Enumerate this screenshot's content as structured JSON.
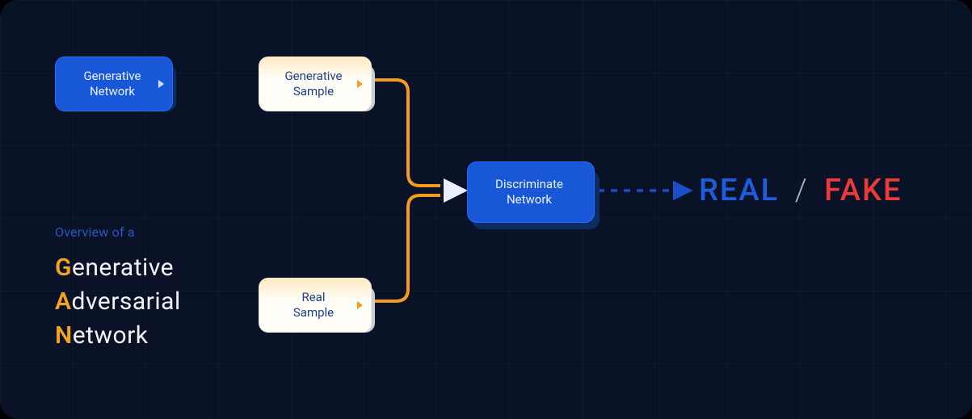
{
  "nodes": {
    "gen_net": {
      "line1": "Generative",
      "line2": "Network"
    },
    "gen_sample": {
      "line1": "Generative",
      "line2": "Sample"
    },
    "real_sample": {
      "line1": "Real",
      "line2": "Sample"
    },
    "discrim": {
      "line1": "Discriminate",
      "line2": "Network"
    }
  },
  "title": {
    "overview": "Overview of a",
    "w1_first": "G",
    "w1_rest": "enerative",
    "w2_first": "A",
    "w2_rest": "dversarial",
    "w3_first": "N",
    "w3_rest": "etwork"
  },
  "output": {
    "real": "REAL",
    "slash": "/",
    "fake": "FAKE"
  },
  "colors": {
    "bg": "#091227",
    "blue_node": "#1857d8",
    "orange": "#f4a321",
    "real": "#1f5de0",
    "fake": "#ea3a3a",
    "connector_orange": "#f59a1f",
    "connector_blue": "#1a4fc7"
  }
}
